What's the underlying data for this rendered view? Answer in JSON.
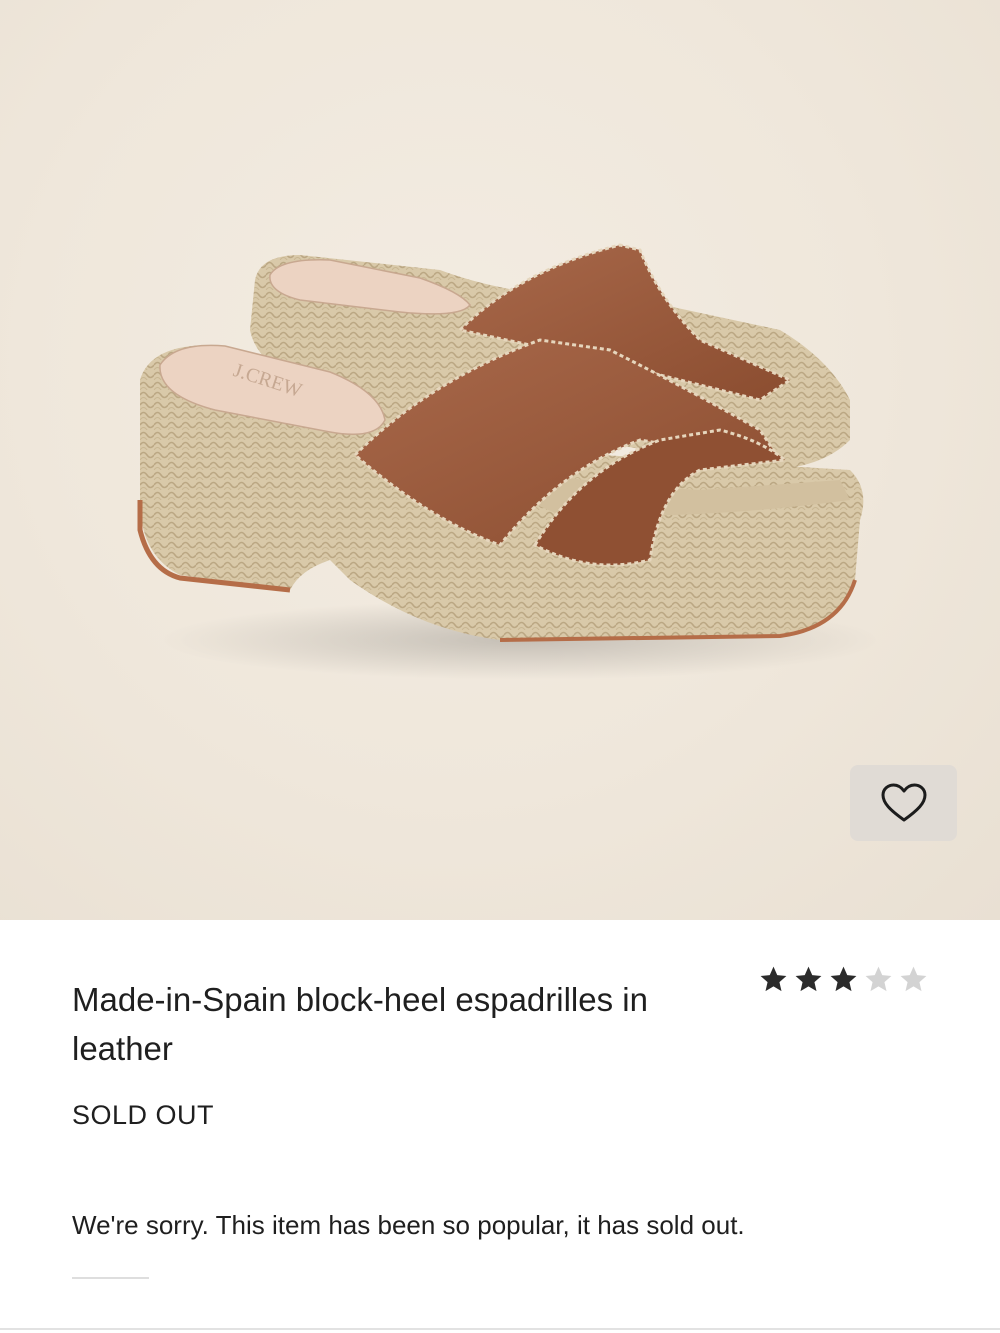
{
  "product": {
    "image_alt": "Made-in-Spain block-heel espadrilles in leather",
    "insole_brand": "J.CREW",
    "title": "Made-in-Spain block-heel espadrilles in leather",
    "status": "SOLD OUT",
    "message": "We're sorry. This item has been so popular, it has sold out.",
    "rating": {
      "value": 3,
      "max": 5
    }
  },
  "favorite": {
    "icon": "heart-outline-icon"
  },
  "colors": {
    "leather": "#9a5a3a",
    "jute": "#d8c8a8",
    "star_filled": "#2b2b2b",
    "star_empty": "#cfcfcf",
    "fav_bg": "#e0dbd5"
  }
}
